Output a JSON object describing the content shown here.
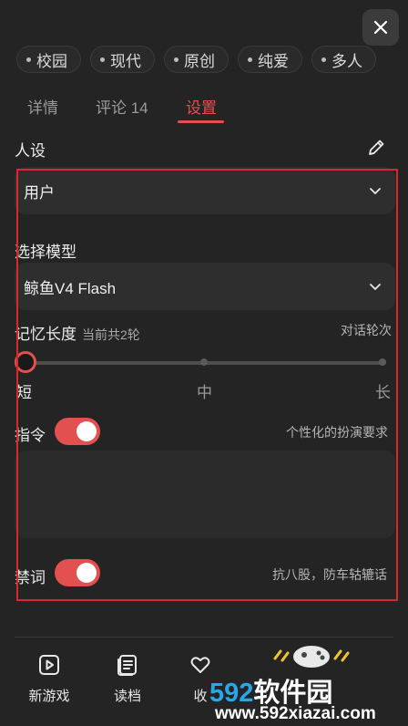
{
  "tags": [
    "校园",
    "现代",
    "原创",
    "纯爱",
    "多人"
  ],
  "tabs": [
    {
      "label": "详情",
      "active": false
    },
    {
      "label": "评论 14",
      "active": false
    },
    {
      "label": "设置",
      "active": true
    }
  ],
  "persona": {
    "label": "人设",
    "selected": "用户"
  },
  "model": {
    "label": "选择模型",
    "selected": "鲸鱼V4 Flash"
  },
  "memory": {
    "label": "记忆长度",
    "current": "当前共2轮",
    "note": "对话轮次",
    "scale": [
      "短",
      "中",
      "长"
    ],
    "level": 0
  },
  "instruction": {
    "label": "指令",
    "enabled": true,
    "note": "个性化的扮演要求",
    "value": ""
  },
  "banned_words": {
    "label": "禁词",
    "enabled": true,
    "note": "抗八股，防车轱辘话"
  },
  "bottom_nav": [
    {
      "label": "新游戏",
      "icon": "play-square-icon"
    },
    {
      "label": "读档",
      "icon": "document-list-icon"
    },
    {
      "label": "收",
      "icon": "heart-icon"
    }
  ],
  "watermark": {
    "brand_number": "592",
    "brand_text": "软件园",
    "url": "www.592xiazai.com"
  },
  "colors": {
    "accent": "#e2504f",
    "background": "#242424",
    "highlight_box": "#d7292d",
    "brand_blue": "#2aa7e8"
  }
}
